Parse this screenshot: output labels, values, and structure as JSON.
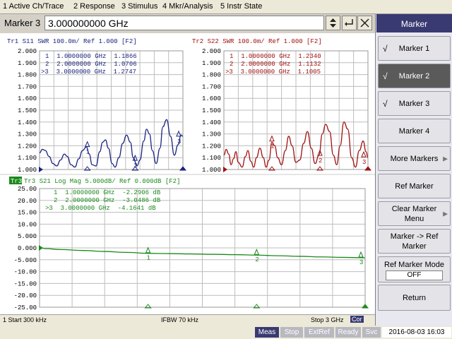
{
  "menu": [
    "1 Active Ch/Trace",
    "2 Response",
    "3 Stimulus",
    "4 Mkr/Analysis",
    "5 Instr State"
  ],
  "entry": {
    "label": "Marker 3",
    "value": "3.000000000 GHz"
  },
  "softkeys": {
    "title": "Marker",
    "marker1": "Marker 1",
    "marker2": "Marker 2",
    "marker3": "Marker 3",
    "marker4": "Marker 4",
    "more_markers": "More Markers",
    "ref_marker": "Ref Marker",
    "clear_marker_menu": "Clear Marker Menu",
    "marker_to_ref": "Marker -> Ref Marker",
    "ref_marker_mode": "Ref Marker Mode",
    "ref_marker_mode_value": "OFF",
    "return": "Return",
    "check": "√"
  },
  "status": {
    "start": "1  Start 300 kHz",
    "ifbw": "IFBW 70 kHz",
    "stop": "Stop 3 GHz",
    "cor": "Cor"
  },
  "bottom": {
    "meas": "Meas",
    "stop": "Stop",
    "extref": "ExtRef",
    "ready": "Ready",
    "svc": "Svc",
    "datetime": "2016-08-03 16:03"
  },
  "colors": {
    "tr1": "#1a237e",
    "tr2": "#a01010",
    "tr3": "#1a8a1a",
    "softkey_header": "#3a3a72",
    "meas": "#3a3a72"
  },
  "chart_data": [
    {
      "type": "line",
      "title": "Tr1  S11  SWR 100.0m/ Ref 1.000 [F2]",
      "ytick_labels": [
        "2.000",
        "1.900",
        "1.800",
        "1.700",
        "1.600",
        "1.500",
        "1.400",
        "1.300",
        "1.200",
        "1.100",
        "1.000"
      ],
      "ylim": [
        1.0,
        2.0
      ],
      "xlim": [
        0.0003,
        3.0
      ],
      "x_unit": "GHz",
      "markers": [
        {
          "label": "1",
          "text": "1  1.0000000 GHz  1.1866"
        },
        {
          "label": "2",
          "text": "2  2.0000000 GHz  1.0706"
        },
        {
          "label": ">3",
          "text": ">3  3.0000000 GHz  1.2747"
        }
      ],
      "marker_x": [
        1.0,
        2.0,
        3.0
      ],
      "marker_y": [
        1.1866,
        1.0706,
        1.2747
      ],
      "series": [
        {
          "x": [
            0.0,
            0.06,
            0.12,
            0.2,
            0.28,
            0.36,
            0.44,
            0.52,
            0.58,
            0.66,
            0.74,
            0.82,
            0.9,
            0.98,
            1.04,
            1.1,
            1.18,
            1.26,
            1.32,
            1.38,
            1.44,
            1.52,
            1.58,
            1.66,
            1.74,
            1.82,
            1.9,
            1.96,
            2.04,
            2.1,
            2.18,
            2.24,
            2.3,
            2.36,
            2.44,
            2.52,
            2.58,
            2.66,
            2.74,
            2.82,
            2.9,
            2.96,
            3.0
          ],
          "y": [
            1.14,
            1.17,
            1.16,
            1.11,
            1.05,
            1.03,
            1.08,
            1.13,
            1.11,
            1.04,
            1.02,
            1.09,
            1.16,
            1.19,
            1.13,
            1.04,
            1.03,
            1.15,
            1.23,
            1.25,
            1.18,
            1.05,
            1.02,
            1.1,
            1.22,
            1.29,
            1.23,
            1.1,
            1.03,
            1.08,
            1.24,
            1.34,
            1.3,
            1.16,
            1.05,
            1.18,
            1.36,
            1.42,
            1.28,
            1.12,
            1.21,
            1.29,
            1.28
          ]
        }
      ]
    },
    {
      "type": "line",
      "title": "Tr2  S22  SWR 100.0m/ Ref 1.000 [F2]",
      "ytick_labels": [
        "2.000",
        "1.900",
        "1.800",
        "1.700",
        "1.600",
        "1.500",
        "1.400",
        "1.300",
        "1.200",
        "1.100",
        "1.000"
      ],
      "ylim": [
        1.0,
        2.0
      ],
      "xlim": [
        0.0003,
        3.0
      ],
      "x_unit": "GHz",
      "markers": [
        {
          "label": "1",
          "text": "1  1.0000000 GHz  1.2340"
        },
        {
          "label": "2",
          "text": "2  2.0000000 GHz  1.1132"
        },
        {
          "label": ">3",
          "text": ">3  3.0000000 GHz  1.1005"
        }
      ],
      "marker_x": [
        1.0,
        2.0,
        3.0
      ],
      "marker_y": [
        1.234,
        1.1132,
        1.1005
      ],
      "series": [
        {
          "x": [
            0.0,
            0.05,
            0.1,
            0.15,
            0.2,
            0.25,
            0.3,
            0.38,
            0.45,
            0.5,
            0.56,
            0.62,
            0.68,
            0.75,
            0.82,
            0.88,
            0.94,
            1.0,
            1.06,
            1.12,
            1.2,
            1.28,
            1.35,
            1.42,
            1.5,
            1.58,
            1.66,
            1.74,
            1.82,
            1.9,
            1.98,
            2.05,
            2.12,
            2.2,
            2.28,
            2.35,
            2.42,
            2.5,
            2.58,
            2.66,
            2.74,
            2.82,
            2.9,
            2.96,
            3.0
          ],
          "y": [
            1.12,
            1.17,
            1.13,
            1.04,
            1.09,
            1.15,
            1.06,
            1.02,
            1.11,
            1.16,
            1.07,
            1.02,
            1.1,
            1.18,
            1.1,
            1.02,
            1.08,
            1.23,
            1.2,
            1.1,
            1.04,
            1.16,
            1.28,
            1.2,
            1.06,
            1.08,
            1.22,
            1.32,
            1.18,
            1.05,
            1.12,
            1.3,
            1.38,
            1.32,
            1.12,
            1.04,
            1.2,
            1.4,
            1.34,
            1.1,
            1.02,
            1.16,
            1.24,
            1.15,
            1.1
          ]
        }
      ]
    },
    {
      "type": "line",
      "title": "Tr3  S21  Log Mag 5.000dB/ Ref 0.000dB [F2]",
      "ytick_labels": [
        "25.00",
        "20.00",
        "15.00",
        "10.00",
        "5.000",
        "0.000",
        "-5.000",
        "-10.00",
        "-15.00",
        "-20.00",
        "-25.00"
      ],
      "ylim": [
        -25,
        25
      ],
      "xlim": [
        0.0003,
        3.0
      ],
      "x_unit": "GHz",
      "markers": [
        {
          "label": "1",
          "text": "1  1.0000000 GHz  -2.2906 dB"
        },
        {
          "label": "2",
          "text": "2  2.0000000 GHz  -3.0486 dB"
        },
        {
          "label": ">3",
          "text": ">3  3.0000000 GHz  -4.1641 dB"
        }
      ],
      "marker_x": [
        1.0,
        2.0,
        3.0
      ],
      "marker_y": [
        -2.2906,
        -3.0486,
        -4.1641
      ],
      "series": [
        {
          "x": [
            0.0,
            0.05,
            0.2,
            0.4,
            0.6,
            0.8,
            1.0,
            1.2,
            1.4,
            1.6,
            1.8,
            2.0,
            2.2,
            2.4,
            2.6,
            2.8,
            3.0
          ],
          "y": [
            0.2,
            -0.3,
            -0.7,
            -1.1,
            -1.5,
            -1.9,
            -2.29,
            -2.4,
            -2.55,
            -2.7,
            -2.85,
            -3.05,
            -3.3,
            -3.55,
            -3.8,
            -4.0,
            -4.16
          ]
        }
      ]
    }
  ]
}
